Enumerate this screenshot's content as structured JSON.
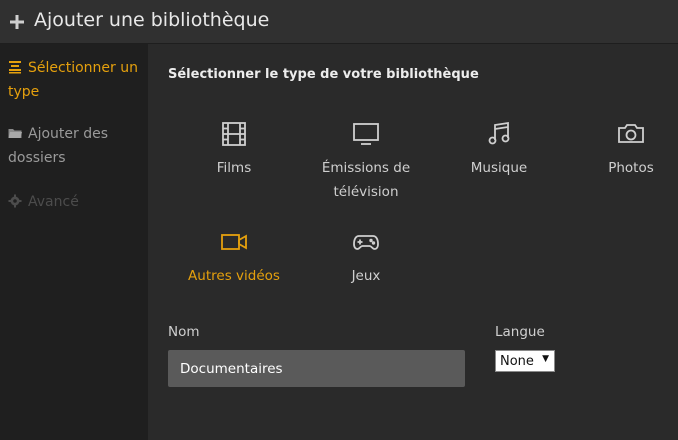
{
  "header": {
    "title": "Ajouter une bibliothèque"
  },
  "sidebar": {
    "items": [
      {
        "label": "Sélectionner un type",
        "icon": "list-icon",
        "state": "active"
      },
      {
        "label": "Ajouter des dossiers",
        "icon": "folder-icon",
        "state": "normal"
      },
      {
        "label": "Avancé",
        "icon": "gear-icon",
        "state": "disabled"
      }
    ]
  },
  "main": {
    "section_title": "Sélectionner le type de votre bibliothèque",
    "types": [
      {
        "label": "Films",
        "icon": "film-icon",
        "selected": false
      },
      {
        "label": "Émissions de télévision",
        "icon": "tv-icon",
        "selected": false
      },
      {
        "label": "Musique",
        "icon": "music-icon",
        "selected": false
      },
      {
        "label": "Photos",
        "icon": "camera-icon",
        "selected": false
      },
      {
        "label": "Autres vidéos",
        "icon": "video-camera-icon",
        "selected": true
      },
      {
        "label": "Jeux",
        "icon": "gamepad-icon",
        "selected": false
      }
    ],
    "name_label": "Nom",
    "name_value": "Documentaires",
    "language_label": "Langue",
    "language_value": "None"
  },
  "colors": {
    "accent": "#e5a00d",
    "background": "#2a2a2a",
    "sidebar": "#1f1f1f",
    "header": "#303030",
    "input": "#5a5a5a"
  }
}
